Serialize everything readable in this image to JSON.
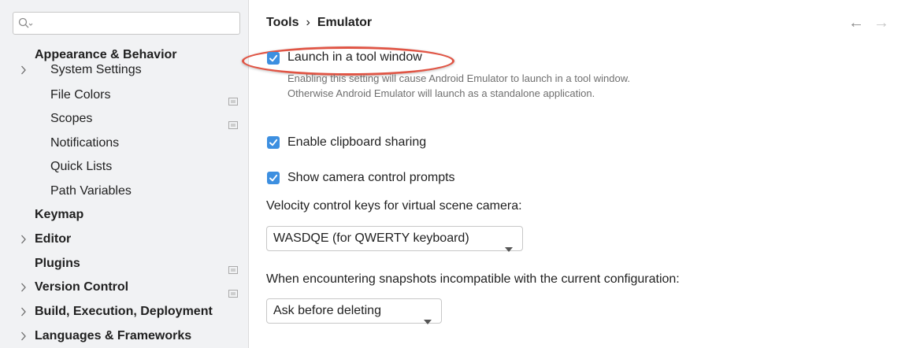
{
  "search": {
    "value": ""
  },
  "sidebar": {
    "items": [
      {
        "label": "Appearance & Behavior"
      },
      {
        "label": "System Settings"
      },
      {
        "label": "File Colors"
      },
      {
        "label": "Scopes"
      },
      {
        "label": "Notifications"
      },
      {
        "label": "Quick Lists"
      },
      {
        "label": "Path Variables"
      },
      {
        "label": "Keymap"
      },
      {
        "label": "Editor"
      },
      {
        "label": "Plugins"
      },
      {
        "label": "Version Control"
      },
      {
        "label": "Build, Execution, Deployment"
      },
      {
        "label": "Languages & Frameworks"
      }
    ]
  },
  "breadcrumb": {
    "parent": "Tools",
    "separator": "›",
    "current": "Emulator"
  },
  "nav": {
    "back": "←",
    "forward": "→"
  },
  "settings": {
    "launch_tool_window": {
      "label": "Launch in a tool window",
      "checked": true,
      "description": "Enabling this setting will cause Android Emulator to launch in a tool window. Otherwise Android Emulator will launch as a standalone application."
    },
    "clipboard_sharing": {
      "label": "Enable clipboard sharing",
      "checked": true
    },
    "camera_prompts": {
      "label": "Show camera control prompts",
      "checked": true
    },
    "velocity_label": "Velocity control keys for virtual scene camera:",
    "velocity_value": "WASDQE (for QWERTY keyboard)",
    "snapshot_label": "When encountering snapshots incompatible with the current configuration:",
    "snapshot_value": "Ask before deleting"
  },
  "colors": {
    "accent": "#3d8fe0",
    "highlight": "#e05545",
    "sidebar_bg": "#f1f2f4"
  }
}
